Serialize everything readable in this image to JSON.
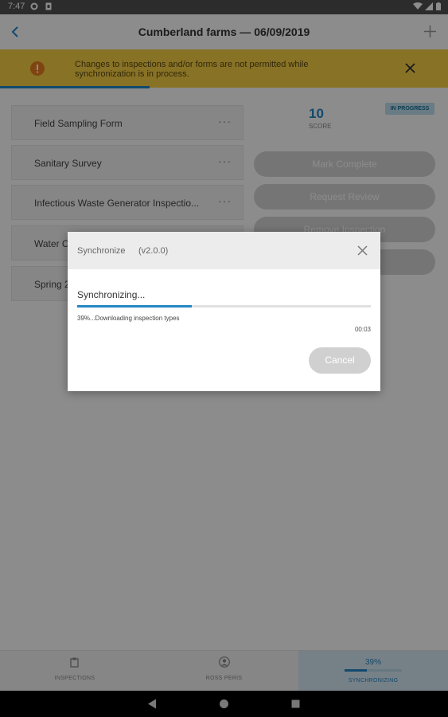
{
  "status_bar": {
    "time": "7:47"
  },
  "app_bar": {
    "title": "Cumberland farms — 06/09/2019"
  },
  "banner": {
    "message": "Changes to inspections and/or forms are not permitted while synchronization is in process."
  },
  "forms": [
    {
      "label": "Field Sampling Form"
    },
    {
      "label": "Sanitary Survey"
    },
    {
      "label": "Infectious Waste Generator Inspectio..."
    },
    {
      "label": "Water C"
    },
    {
      "label": "Spring 2"
    }
  ],
  "more_glyph": "···",
  "score": {
    "value": "10",
    "label": "SCORE"
  },
  "status_badge": "IN PROGRESS",
  "actions": {
    "mark_complete": "Mark Complete",
    "request_review": "Request Review",
    "remove_inspection": "Remove Inspection"
  },
  "bottom_nav": {
    "inspections": "INSPECTIONS",
    "ross_peris": "ROSS PERIS",
    "sync_percent": "39%",
    "synchronizing": "SYNCHRONIZING"
  },
  "dialog": {
    "title": "Synchronize",
    "version": "(v2.0.0)",
    "sync_label": "Synchronizing...",
    "progress": 0.39,
    "detail": "39%...Downloading inspection types",
    "elapsed": "00:03",
    "cancel_label": "Cancel"
  },
  "colors": {
    "accent": "#2586c6",
    "banner": "#f7d046",
    "warning_icon": "#e87c1e"
  }
}
